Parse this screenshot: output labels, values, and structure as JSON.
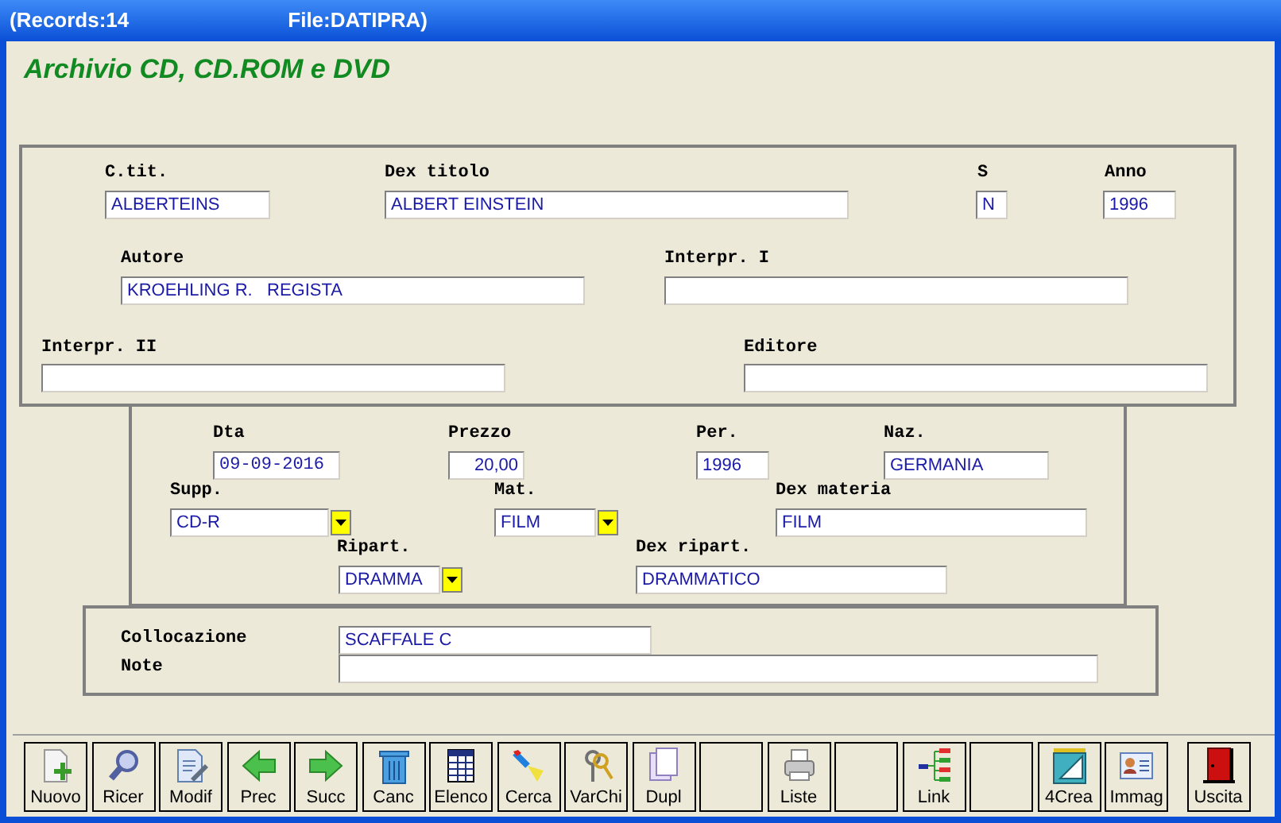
{
  "title_bar": {
    "records": "(Records:14",
    "file": "File:DATIPRA)"
  },
  "heading": "Archivio CD, CD.ROM e DVD",
  "fields": [
    {
      "label": "C.tit.",
      "kind": "text",
      "value": "ALBERTEINS"
    },
    {
      "label": "Dex titolo",
      "kind": "text",
      "value": "ALBERT EINSTEIN"
    },
    {
      "label": "S",
      "kind": "text",
      "value": "N"
    },
    {
      "label": "Anno",
      "kind": "text",
      "value": "1996"
    },
    {
      "label": "Autore",
      "kind": "text",
      "value": "KROEHLING R.   REGISTA"
    },
    {
      "label": "Interpr. I",
      "kind": "text"
    },
    {
      "label": "Interpr. II",
      "kind": "text"
    },
    {
      "label": "Editore",
      "kind": "text"
    },
    {
      "label": "Dta",
      "kind": "text",
      "value": "09-09-2016"
    },
    {
      "label": "Prezzo",
      "kind": "text",
      "value": "20,00"
    },
    {
      "label": "Per.",
      "kind": "text",
      "value": "1996"
    },
    {
      "label": "Naz.",
      "kind": "text",
      "value": "GERMANIA"
    },
    {
      "label": "Supp.",
      "kind": "combo",
      "value": "CD-R"
    },
    {
      "label": "Mat.",
      "kind": "combo",
      "value": "FILM"
    },
    {
      "label": "Dex materia",
      "kind": "text",
      "value": "FILM"
    },
    {
      "label": "Ripart.",
      "kind": "combo",
      "value": "DRAMMA"
    },
    {
      "label": "Dex ripart.",
      "kind": "text",
      "value": "DRAMMATICO"
    },
    {
      "label": "Collocazione",
      "kind": "text",
      "value": "SCAFFALE C"
    },
    {
      "label": "Note",
      "kind": "text"
    }
  ],
  "toolbar": [
    {
      "kind": "command",
      "label": "Nuovo"
    },
    {
      "kind": "command",
      "label": "Ricer"
    },
    {
      "kind": "command",
      "label": "Modif"
    },
    {
      "kind": "command",
      "label": "Prec"
    },
    {
      "kind": "command",
      "label": "Succ"
    },
    {
      "kind": "command",
      "label": "Canc"
    },
    {
      "kind": "command",
      "label": "Elenco"
    },
    {
      "kind": "command",
      "label": "Cerca"
    },
    {
      "kind": "command",
      "label": "VarChi"
    },
    {
      "kind": "command",
      "label": "Dupl"
    },
    {
      "kind": "blank"
    },
    {
      "kind": "command",
      "label": "Liste"
    },
    {
      "kind": "blank"
    },
    {
      "kind": "command",
      "label": "Link"
    },
    {
      "kind": "blank"
    },
    {
      "kind": "command",
      "label": "4Crea"
    },
    {
      "kind": "command",
      "label": "Immag"
    },
    {
      "kind": "command",
      "label": "Uscita"
    }
  ]
}
